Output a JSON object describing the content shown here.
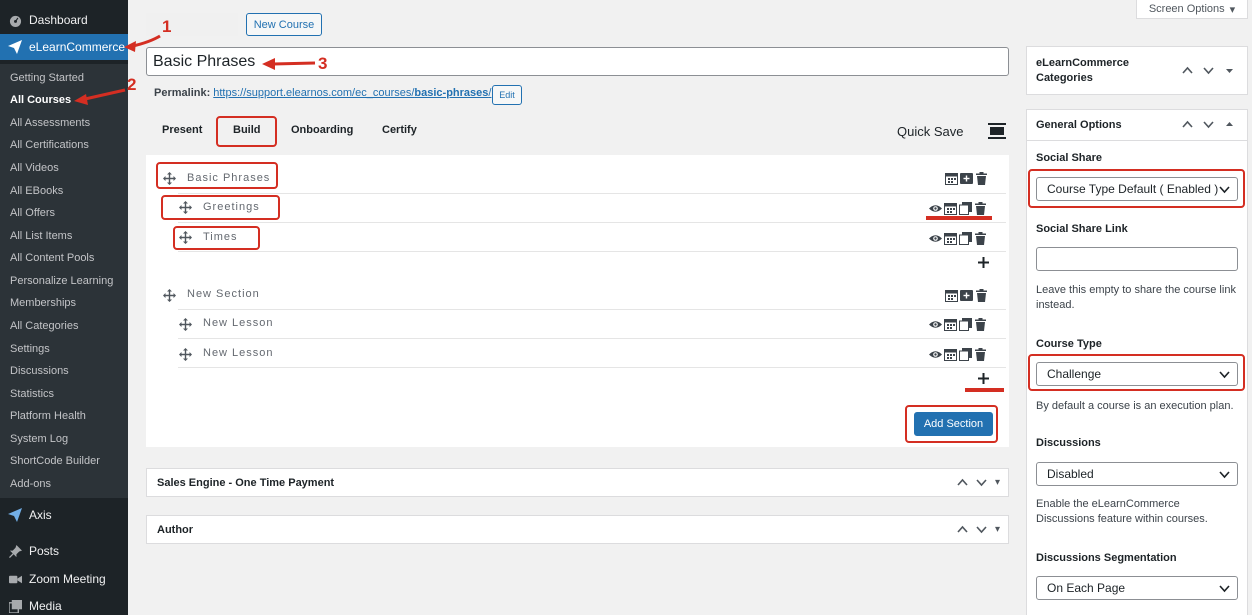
{
  "sidebar": {
    "dashboard": "Dashboard",
    "elearn": "eLearnCommerce",
    "items": [
      "Getting Started",
      "All Courses",
      "All Assessments",
      "All Certifications",
      "All Videos",
      "All EBooks",
      "All Offers",
      "All List Items",
      "All Content Pools",
      "Personalize Learning",
      "Memberships",
      "All Categories",
      "Settings",
      "Discussions",
      "Statistics",
      "Platform Health",
      "System Log",
      "ShortCode Builder",
      "Add-ons"
    ],
    "axis": "Axis",
    "posts": "Posts",
    "zoom": "Zoom Meeting",
    "media": "Media"
  },
  "top": {
    "new_course": "New Course",
    "screen_options": "Screen Options"
  },
  "editor": {
    "title": "Basic Phrases",
    "permalink_label": "Permalink:",
    "permalink_base": "https://support.elearnos.com/ec_courses/",
    "permalink_slug": "basic-phrases",
    "permalink_trail": "/",
    "edit": "Edit"
  },
  "tabs": [
    "Present",
    "Build",
    "Onboarding",
    "Certify"
  ],
  "quick_save": "Quick Save",
  "builder": {
    "sections": [
      {
        "label": "Basic Phrases",
        "lessons": [
          "Greetings",
          "Times"
        ]
      },
      {
        "label": "New Section",
        "lessons": [
          "New Lesson",
          "New Lesson"
        ]
      }
    ],
    "add_section": "Add Section"
  },
  "boxes": {
    "sales": "Sales Engine - One Time Payment",
    "author": "Author"
  },
  "right": {
    "categories_title_1": "eLearnCommerce",
    "categories_title_2": "Categories",
    "general_title": "General Options",
    "social_share_label": "Social Share",
    "social_share_value": "Course Type Default ( Enabled )",
    "social_share_link_label": "Social Share Link",
    "social_share_link_help": "Leave this empty to share the course link instead.",
    "course_type_label": "Course Type",
    "course_type_value": "Challenge",
    "course_type_help": "By default a course is an execution plan.",
    "discussions_label": "Discussions",
    "discussions_value": "Disabled",
    "discussions_help": "Enable the eLearnCommerce Discussions feature within courses.",
    "segmentation_label": "Discussions Segmentation",
    "segmentation_value": "On Each Page"
  },
  "annotations": [
    "1",
    "2",
    "3"
  ],
  "colors": {
    "accent": "#2271b1",
    "annotation": "#d42e22",
    "sidebar": "#1d2327"
  }
}
